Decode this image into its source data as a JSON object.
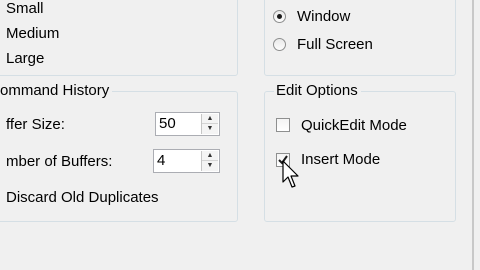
{
  "cursor_size": {
    "options": [
      "Small",
      "Medium",
      "Large"
    ]
  },
  "display_options": {
    "window_label": "Window",
    "window_selected": true,
    "fullscreen_label": "Full Screen",
    "fullscreen_selected": false
  },
  "command_history": {
    "title": "ommand History",
    "buffer_size_label": "ffer Size:",
    "buffer_size_value": "50",
    "num_buffers_label": "mber of Buffers:",
    "num_buffers_value": "4",
    "discard_label": "Discard Old Duplicates",
    "discard_checked": false
  },
  "edit_options": {
    "title": "Edit Options",
    "quickedit_label": "QuickEdit Mode",
    "quickedit_checked": false,
    "insert_label": "Insert Mode",
    "insert_checked": true
  }
}
